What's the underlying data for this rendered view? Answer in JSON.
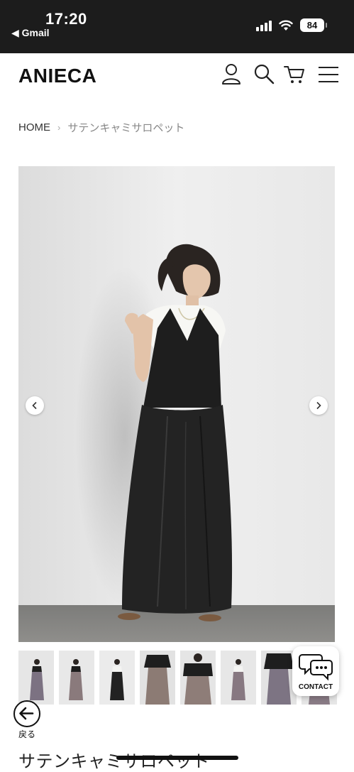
{
  "status_bar": {
    "time": "17:20",
    "back_app": "◀ Gmail",
    "battery": "84",
    "icons": [
      "signal-icon",
      "wifi-icon",
      "battery-icon"
    ]
  },
  "header": {
    "logo": "ANIECA",
    "icons": [
      "account-icon",
      "search-icon",
      "cart-icon",
      "menu-icon"
    ]
  },
  "breadcrumb": {
    "home": "HOME",
    "separator": "›",
    "current": "サテンキャミサロペット"
  },
  "gallery": {
    "prev_icon": "chevron-left-icon",
    "next_icon": "chevron-right-icon",
    "thumbnail_count": 8
  },
  "contact": {
    "label": "CONTACT",
    "icon": "chat-bubbles-icon"
  },
  "back": {
    "label": "戻る",
    "icon": "arrow-left-circle-icon"
  },
  "product": {
    "title": "サテンキャミサロペット"
  },
  "colors": {
    "status_bar_bg": "#1c1c1c",
    "text": "#111111",
    "breadcrumb_current": "#888888"
  }
}
